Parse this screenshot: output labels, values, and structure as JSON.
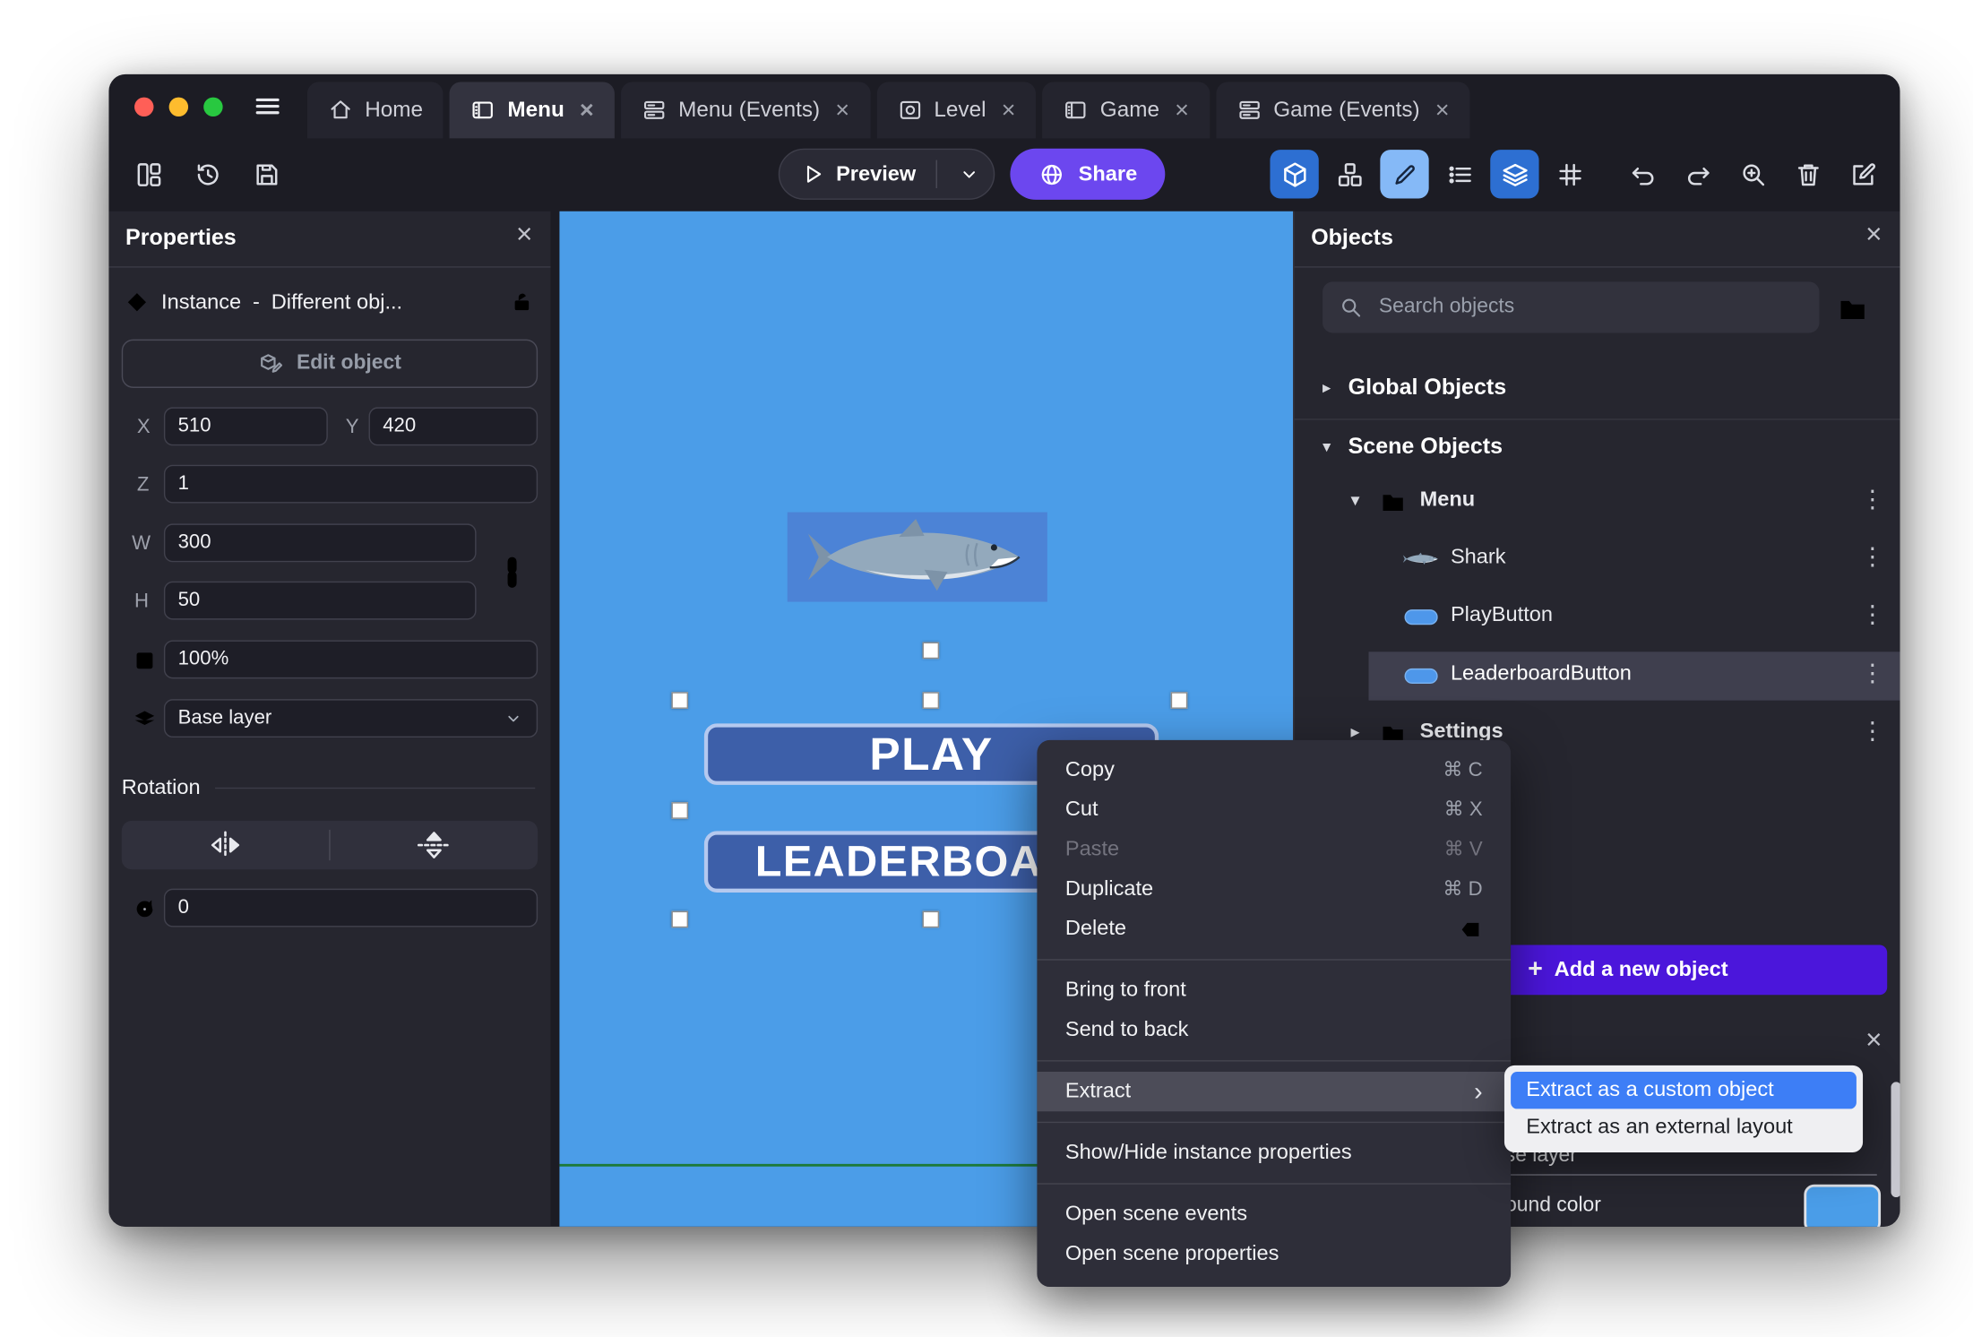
{
  "icons": {
    "close": "×",
    "kebab": "⋮",
    "collapsed": "▸",
    "expanded": "▾",
    "submenu_arrow": "›",
    "plus": "+"
  },
  "tabs": {
    "home": "Home",
    "menu": "Menu",
    "menu_events": "Menu (Events)",
    "level": "Level",
    "game": "Game",
    "game_events": "Game (Events)"
  },
  "toolbar": {
    "preview": "Preview",
    "share": "Share"
  },
  "properties": {
    "title": "Properties",
    "instance_type": "Instance",
    "instance_dash": "-",
    "instance_detail": "Different obj...",
    "edit_object": "Edit object",
    "x_label": "X",
    "x": "510",
    "y_label": "Y",
    "y": "420",
    "z_label": "Z",
    "z": "1",
    "w_label": "W",
    "w": "300",
    "h_label": "H",
    "h": "50",
    "opacity": "100%",
    "layer": "Base layer",
    "rotation_title": "Rotation",
    "rotation": "0"
  },
  "canvas": {
    "play": "PLAY",
    "leaderboard": "LEADERBOARD"
  },
  "context_menu": {
    "copy": "Copy",
    "copy_sc": "⌘ C",
    "cut": "Cut",
    "cut_sc": "⌘ X",
    "paste": "Paste",
    "paste_sc": "⌘ V",
    "duplicate": "Duplicate",
    "duplicate_sc": "⌘ D",
    "delete": "Delete",
    "bring_to_front": "Bring to front",
    "send_to_back": "Send to back",
    "extract": "Extract",
    "show_hide": "Show/Hide instance properties",
    "open_events": "Open scene events",
    "open_props": "Open scene properties"
  },
  "submenu": {
    "custom_object": "Extract as a custom object",
    "external_layout": "Extract as an external layout"
  },
  "objects": {
    "title": "Objects",
    "search_placeholder": "Search objects",
    "global": "Global Objects",
    "scene": "Scene Objects",
    "folder_menu": "Menu",
    "shark": "Shark",
    "play_button": "PlayButton",
    "leaderboard_button": "LeaderboardButton",
    "folder_settings": "Settings",
    "add_new": "Add a new object"
  },
  "bottom_panel": {
    "layer": "Base layer",
    "bg_color": "Background color"
  },
  "colors": {
    "canvas_blue": "#4B9DE8",
    "game_button_blue": "#3D5FA9",
    "share_purple": "#6C47EF",
    "add_object_purple": "#4B16DB",
    "submenu_selection_blue": "#3D7EF6",
    "toolbar_highlight_blue": "#2D6FD2",
    "swatch_blue": "#4A9DE8"
  }
}
